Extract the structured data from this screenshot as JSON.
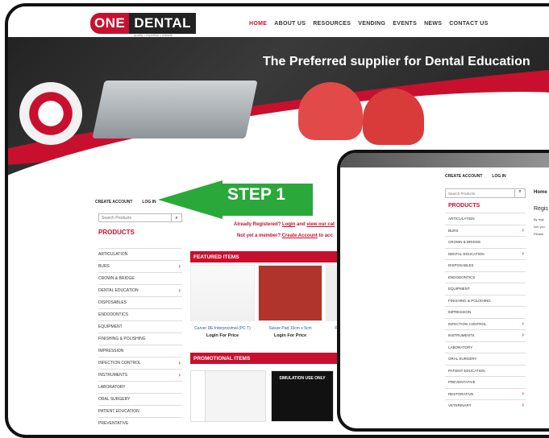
{
  "logo": {
    "one": "ONE",
    "dental": "DENTAL",
    "tagline": "quality • expertise • reliable"
  },
  "nav": [
    "HOME",
    "ABOUT US",
    "RESOURCES",
    "VENDING",
    "EVENTS",
    "NEWS",
    "CONTACT US"
  ],
  "hero": {
    "title": "The Preferred supplier for Dental Education"
  },
  "callout": {
    "label": "STEP 1",
    "color": "#2ba83a"
  },
  "account": {
    "create": "CREATE ACCOUNT",
    "login": "LOG IN"
  },
  "search": {
    "placeholder": "Search Products",
    "icon": "search-icon"
  },
  "products_heading": "PRODUCTS",
  "categories": [
    {
      "label": "ARTICULATION",
      "chevron": false
    },
    {
      "label": "BURS",
      "chevron": true
    },
    {
      "label": "CROWN & BRIDGE",
      "chevron": false
    },
    {
      "label": "DENTAL EDUCATION",
      "chevron": true
    },
    {
      "label": "DISPOSABLES",
      "chevron": false
    },
    {
      "label": "ENDODONTICS",
      "chevron": false
    },
    {
      "label": "EQUIPMENT",
      "chevron": false
    },
    {
      "label": "FINISHING & POLISHING",
      "chevron": false
    },
    {
      "label": "IMPRESSION",
      "chevron": false
    },
    {
      "label": "INFECTION CONTROL",
      "chevron": true
    },
    {
      "label": "INSTRUMENTS",
      "chevron": true
    },
    {
      "label": "LABORATORY",
      "chevron": false
    },
    {
      "label": "ORAL SURGERY",
      "chevron": false
    },
    {
      "label": "PATIENT EDUCATION",
      "chevron": false
    },
    {
      "label": "PREVENTATIVE",
      "chevron": false
    }
  ],
  "messages": {
    "registered_prefix": "Already Registered?",
    "login_link": "Login",
    "and": "and",
    "view_link": "view our cat",
    "not_member": "Not yet a member?",
    "create_link": "Create Account",
    "to": "to acc"
  },
  "featured": {
    "heading": "FEATURED ITEMS",
    "items": [
      {
        "name": "Carver DE Interproximal (PC T)",
        "price": "Login For Price"
      },
      {
        "name": "Suture Pad 10cm x 5cm",
        "price": "Login For Price"
      },
      {
        "name": "Perio M",
        "price": "Log"
      }
    ]
  },
  "promotional": {
    "heading": "PROMOTIONAL ITEMS",
    "badge": "SIMULATION USE ONLY"
  },
  "mobile": {
    "account": {
      "create": "CREATE ACCOUNT",
      "login": "LOG IN"
    },
    "search_placeholder": "Search Products",
    "products_heading": "PRODUCTS",
    "home": "Home",
    "register_title": "Regis",
    "lines": [
      "By regi",
      "Are you",
      "Please"
    ],
    "categories": [
      {
        "label": "ARTICULATION",
        "chevron": false
      },
      {
        "label": "BURS",
        "chevron": true
      },
      {
        "label": "CROWN & BRIDGE",
        "chevron": false
      },
      {
        "label": "DENTAL EDUCATION",
        "chevron": true
      },
      {
        "label": "DISPOSABLES",
        "chevron": false
      },
      {
        "label": "ENDODONTICS",
        "chevron": false
      },
      {
        "label": "EQUIPMENT",
        "chevron": false
      },
      {
        "label": "FINISHING & POLISHING",
        "chevron": false
      },
      {
        "label": "IMPRESSION",
        "chevron": false
      },
      {
        "label": "INFECTION CONTROL",
        "chevron": true
      },
      {
        "label": "INSTRUMENTS",
        "chevron": true
      },
      {
        "label": "LABORATORY",
        "chevron": false
      },
      {
        "label": "ORAL SURGERY",
        "chevron": false
      },
      {
        "label": "PATIENT EDUCATION",
        "chevron": false
      },
      {
        "label": "PREVENTATIVE",
        "chevron": false
      },
      {
        "label": "RESTORATIVE",
        "chevron": true
      },
      {
        "label": "VETERINARY",
        "chevron": true
      }
    ]
  },
  "colors": {
    "brand": "#c8102e",
    "arrow": "#2ba83a"
  }
}
